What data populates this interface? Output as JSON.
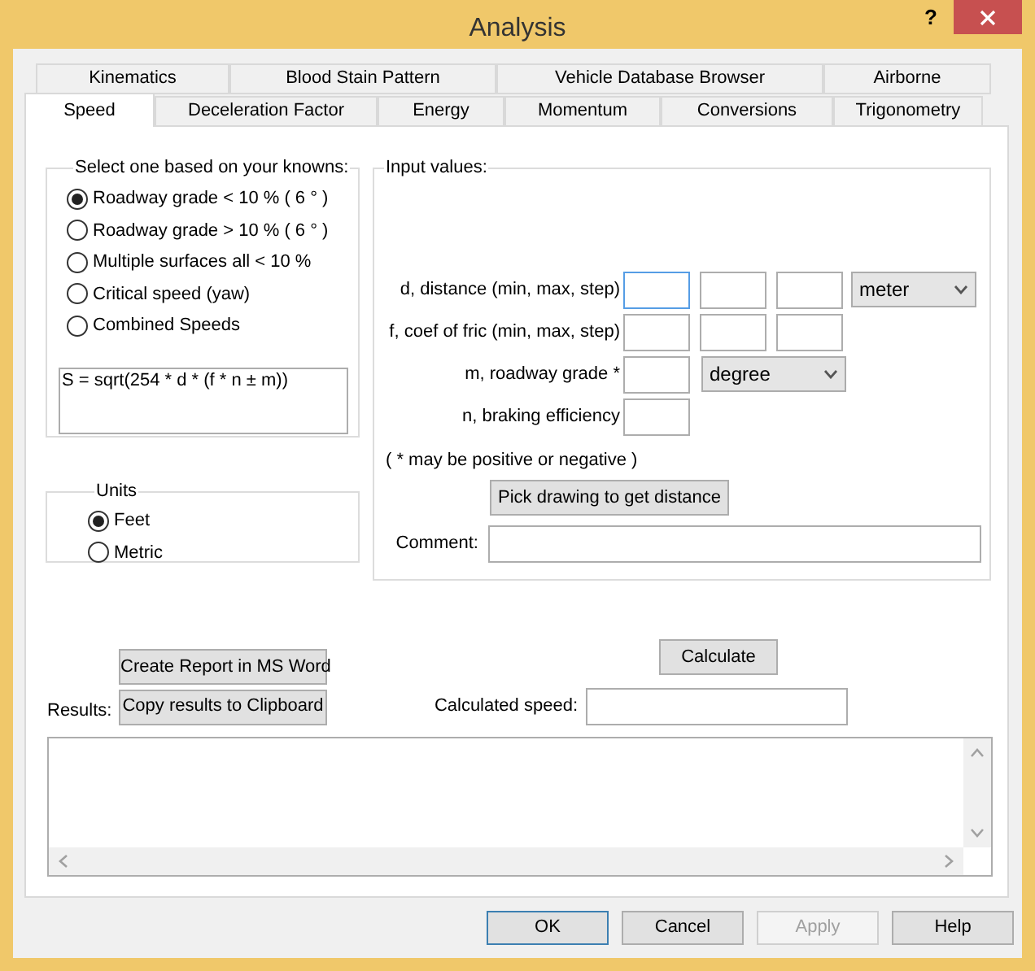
{
  "window": {
    "title": "Analysis",
    "help": "?"
  },
  "tab_rows": [
    {
      "tabs": [
        {
          "label": "Kinematics",
          "selected": false
        },
        {
          "label": "Blood Stain Pattern",
          "selected": false
        },
        {
          "label": "Vehicle Database Browser",
          "selected": false
        },
        {
          "label": "Airborne",
          "selected": false
        }
      ]
    },
    {
      "tabs": [
        {
          "label": "Speed",
          "selected": true
        },
        {
          "label": "Deceleration Factor",
          "selected": false
        },
        {
          "label": "Energy",
          "selected": false
        },
        {
          "label": "Momentum",
          "selected": false
        },
        {
          "label": "Conversions",
          "selected": false
        },
        {
          "label": "Trigonometry",
          "selected": false
        }
      ]
    }
  ],
  "knowns": {
    "title": "Select one based on your knowns:",
    "options": [
      {
        "label": "Roadway grade < 10 % ( 6 ° )",
        "selected": true
      },
      {
        "label": "Roadway grade > 10 % ( 6 ° )",
        "selected": false
      },
      {
        "label": "Multiple surfaces all < 10 %",
        "selected": false
      },
      {
        "label": "Critical speed (yaw)",
        "selected": false
      },
      {
        "label": "Combined Speeds",
        "selected": false
      }
    ],
    "formula": "S = sqrt(254 * d * (f * n ± m))"
  },
  "units": {
    "title": "Units",
    "options": [
      {
        "label": "Feet",
        "selected": true
      },
      {
        "label": "Metric",
        "selected": false
      }
    ]
  },
  "inputs": {
    "title": "Input values:",
    "rows": [
      {
        "label": "d, distance (min, max, step)",
        "kind": "range",
        "focused": true,
        "unit": "meter"
      },
      {
        "label": "f, coef of fric (min, max, step)",
        "kind": "range",
        "focused": false
      },
      {
        "label": "m, roadway grade *",
        "kind": "single",
        "focused": false,
        "unit": "degree"
      },
      {
        "label": "n, braking efficiency",
        "kind": "single",
        "focused": false
      }
    ],
    "note": "( * may be positive or negative )",
    "pick_button": "Pick drawing to get distance",
    "comment_label": "Comment:"
  },
  "report_button": "Create Report in MS Word",
  "results_label": "Results:",
  "copy_button": "Copy results to Clipboard",
  "calculate_button": "Calculate",
  "speed_label": "Calculated speed:",
  "buttons": [
    {
      "label": "OK",
      "default": true,
      "disabled": false
    },
    {
      "label": "Cancel",
      "default": false,
      "disabled": false
    },
    {
      "label": "Apply",
      "default": false,
      "disabled": true
    },
    {
      "label": "Help",
      "default": false,
      "disabled": false
    }
  ]
}
